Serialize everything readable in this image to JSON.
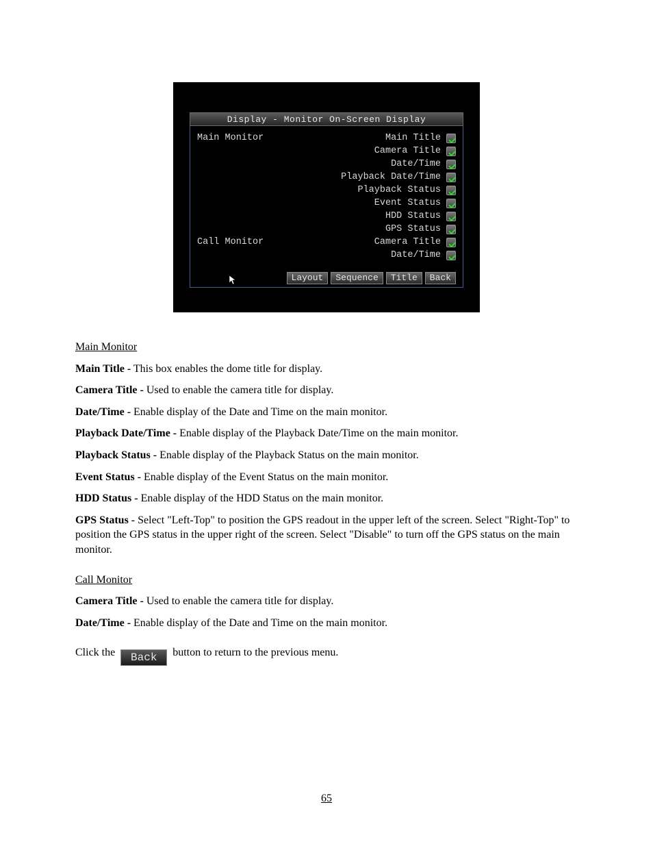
{
  "screenshot": {
    "title": "Display - Monitor On-Screen Display",
    "rows": [
      {
        "section": "Main Monitor",
        "label": "Main Title",
        "checked": true
      },
      {
        "section": "",
        "label": "Camera Title",
        "checked": true
      },
      {
        "section": "",
        "label": "Date/Time",
        "checked": true
      },
      {
        "section": "",
        "label": "Playback Date/Time",
        "checked": true
      },
      {
        "section": "",
        "label": "Playback Status",
        "checked": true
      },
      {
        "section": "",
        "label": "Event Status",
        "checked": true
      },
      {
        "section": "",
        "label": "HDD Status",
        "checked": true
      },
      {
        "section": "",
        "label": "GPS Status",
        "checked": true
      },
      {
        "section": "Call Monitor",
        "label": "Camera Title",
        "checked": true
      },
      {
        "section": "",
        "label": "Date/Time",
        "checked": true
      }
    ],
    "buttons": {
      "layout": "Layout",
      "sequence": "Sequence",
      "title": "Title",
      "back": "Back"
    }
  },
  "sections": {
    "main": {
      "heading": "Main Monitor",
      "p1_label": "Main Title -",
      "p1_text": " This box enables the dome title for display.",
      "p2_label": "Camera Title -",
      "p2_text": " Used to enable the camera title for display.",
      "p3_label": "Date/Time -",
      "p3_text": " Enable display of the Date and Time on the main monitor.",
      "p4_label": "Playback Date/Time -",
      "p4_text": " Enable display of the Playback Date/Time on the main monitor.",
      "p5_label": "Playback Status -",
      "p5_text": " Enable display of the Playback Status on the main monitor.",
      "p6_label": "Event Status -",
      "p6_text": " Enable display of the Event Status on the main monitor.",
      "p7_label": "HDD Status -",
      "p7_text": " Enable display of the HDD Status on the main monitor.",
      "p8_label": "GPS Status -",
      "p8_text": " Select \"Left-Top\" to position the GPS readout in the upper left of the screen. Select \"Right-Top\" to position the GPS status in the upper right of the screen. Select \"Disable\" to turn off the GPS status on the main monitor."
    },
    "call": {
      "heading": "Call Monitor",
      "p1_label": "Camera Title -",
      "p1_text": " Used to enable the camera title for display.",
      "p2_label": "Date/Time -",
      "p2_text": " Enable display of the Date and Time on the main monitor."
    },
    "back": {
      "label": "Back",
      "pre": "Click the ",
      "post": " button to return to the previous menu."
    }
  },
  "page_number": "65"
}
